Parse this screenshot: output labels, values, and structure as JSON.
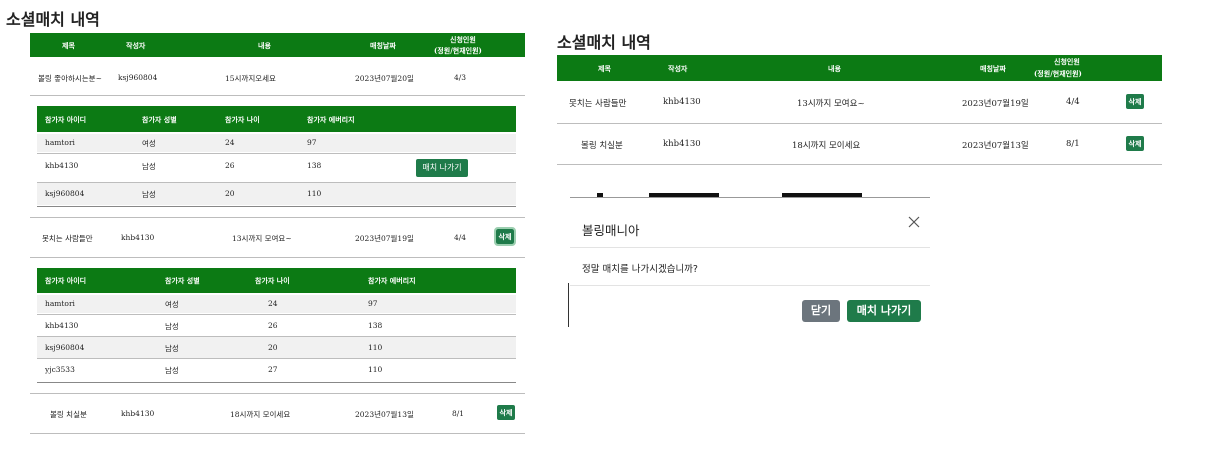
{
  "left": {
    "title": "소셜매치 내역",
    "columns": [
      "제목",
      "작성자",
      "내용",
      "매칭날짜",
      "신청인원",
      "(정원/현재인원)"
    ],
    "matches": [
      {
        "title": "볼링 좋아하시는분~",
        "author": "ksj960804",
        "content": "15시까지오세요",
        "date": "2023년07월20일",
        "count": "4/3"
      },
      {
        "title": "못치는 사람들만",
        "author": "khb4130",
        "content": "13시까지 모여요~",
        "date": "2023년07월19일",
        "count": "4/4",
        "action": "삭제"
      },
      {
        "title": "볼링 치실분",
        "author": "khb4130",
        "content": "18시까지 모이세요",
        "date": "2023년07월13일",
        "count": "8/1",
        "action": "삭제"
      }
    ],
    "participant_columns": [
      "참가자 아이디",
      "참가자 성별",
      "참가자 나이",
      "참가자 에버리지"
    ],
    "participants_1": [
      {
        "id": "hamtori",
        "gender": "여성",
        "age": "24",
        "avg": "97"
      },
      {
        "id": "khb4130",
        "gender": "남성",
        "age": "26",
        "avg": "138"
      },
      {
        "id": "ksj960804",
        "gender": "남성",
        "age": "20",
        "avg": "110"
      }
    ],
    "leave_button": "매치 나가기",
    "participants_2": [
      {
        "id": "hamtori",
        "gender": "여성",
        "age": "24",
        "avg": "97"
      },
      {
        "id": "khb4130",
        "gender": "남성",
        "age": "26",
        "avg": "138"
      },
      {
        "id": "ksj960804",
        "gender": "남성",
        "age": "20",
        "avg": "110"
      },
      {
        "id": "yjc3533",
        "gender": "남성",
        "age": "27",
        "avg": "110"
      }
    ]
  },
  "right": {
    "title": "소셜매치 내역",
    "columns": [
      "제목",
      "작성자",
      "내용",
      "매칭날짜",
      "신청인원",
      "(정원/현재인원)"
    ],
    "matches": [
      {
        "title": "못치는 사람들만",
        "author": "khb4130",
        "content": "13시까지 모여요~",
        "date": "2023년07월19일",
        "count": "4/4",
        "action": "삭제"
      },
      {
        "title": "볼링 치실분",
        "author": "khb4130",
        "content": "18시까지 모이세요",
        "date": "2023년07월13일",
        "count": "8/1",
        "action": "삭제"
      }
    ]
  },
  "modal": {
    "title": "볼링매니아",
    "message": "정말 매치를 나가시겠습니까?",
    "close_label": "닫기",
    "confirm_label": "매치 나가기",
    "close_icon": "close-icon"
  },
  "colors": {
    "header_green": "#0c7a14",
    "button_green": "#1f7b4a",
    "button_gray": "#6c757d"
  }
}
